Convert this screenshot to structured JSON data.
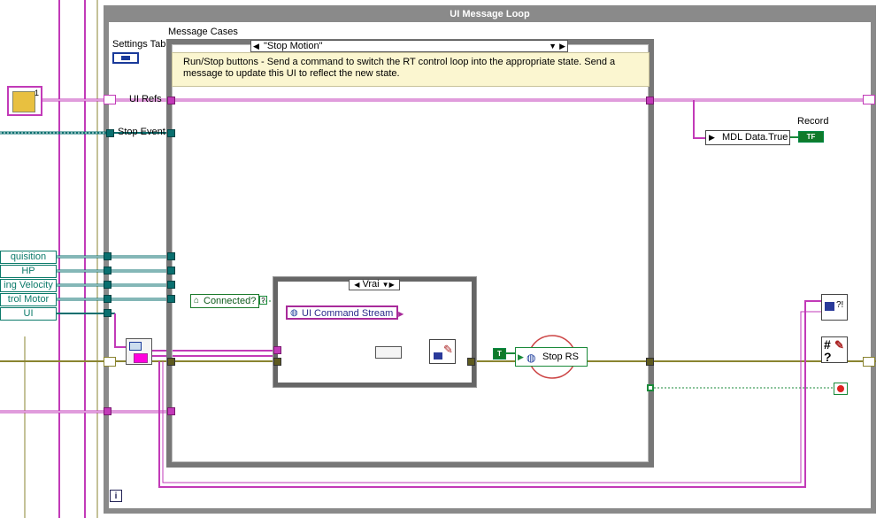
{
  "loop": {
    "title": "UI Message Loop"
  },
  "case_structure": {
    "label": "Message Cases",
    "selector_value": "\"Stop Motion\"",
    "comment": "Run/Stop buttons - Send a command to switch the RT control loop into the appropriate state. Send a message to update this UI to reflect the new state."
  },
  "inner_case": {
    "selector_value": "Vrai"
  },
  "left_labels": {
    "settings_tab": "Settings Tab",
    "ui_refs": "UI Refs",
    "stop_event": "Stop Event"
  },
  "left_controls": [
    "quisition",
    "HP",
    "ing Velocity",
    "trol Motor",
    "UI"
  ],
  "nodes": {
    "connected": "Connected?",
    "ui_command_stream": "UI Command Stream",
    "stop_rs": "Stop RS",
    "true_const": "T",
    "mdl_data_true": "MDL Data.True",
    "record_label": "Record",
    "record_terminal": "TF",
    "info_icon": "i"
  },
  "colors": {
    "loop_frame": "#8a8a8a",
    "pink_wire": "#c23ab8",
    "teal_wire": "#0a6f6f",
    "olive_wire": "#8a8430",
    "green_wire": "#1a8a3a",
    "comment_bg": "#fbf6d0"
  }
}
